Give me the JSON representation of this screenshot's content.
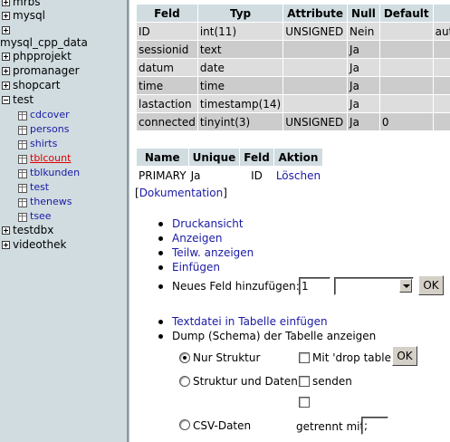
{
  "tree": {
    "databases": [
      {
        "name": "mrbs",
        "expanded": false
      },
      {
        "name": "mysql",
        "expanded": false
      },
      {
        "name": "mysql_cpp_data",
        "expanded": false
      },
      {
        "name": "phpprojekt",
        "expanded": false
      },
      {
        "name": "promanager",
        "expanded": false
      },
      {
        "name": "shopcart",
        "expanded": false
      },
      {
        "name": "test",
        "expanded": true
      },
      {
        "name": "testdbx",
        "expanded": false
      },
      {
        "name": "videothek",
        "expanded": false
      }
    ],
    "test_tables": [
      "cdcover",
      "persons",
      "shirts",
      "tblcount",
      "tblkunden",
      "test",
      "thenews",
      "tsee"
    ],
    "active_table": "tblcount"
  },
  "fields_table": {
    "headers": [
      "Feld",
      "Typ",
      "Attribute",
      "Null",
      "Default"
    ],
    "rows": [
      {
        "feld": "ID",
        "typ": "int(11)",
        "attribute": "UNSIGNED",
        "null": "Nein",
        "default": "",
        "extra": "auto"
      },
      {
        "feld": "sessionid",
        "typ": "text",
        "attribute": "",
        "null": "Ja",
        "default": "",
        "extra": ""
      },
      {
        "feld": "datum",
        "typ": "date",
        "attribute": "",
        "null": "Ja",
        "default": "",
        "extra": ""
      },
      {
        "feld": "time",
        "typ": "time",
        "attribute": "",
        "null": "Ja",
        "default": "",
        "extra": ""
      },
      {
        "feld": "lastaction",
        "typ": "timestamp(14)",
        "attribute": "",
        "null": "Ja",
        "default": "",
        "extra": ""
      },
      {
        "feld": "connected",
        "typ": "tinyint(3)",
        "attribute": "UNSIGNED",
        "null": "Ja",
        "default": "0",
        "extra": ""
      }
    ]
  },
  "index_table": {
    "headers": [
      "Name",
      "Unique",
      "Feld",
      "Aktion"
    ],
    "rows": [
      {
        "name": "PRIMARY",
        "unique": "Ja",
        "feld": "ID",
        "aktion": "Löschen"
      }
    ]
  },
  "doc_link": {
    "open": "[",
    "label": "Dokumentation",
    "close": "]"
  },
  "actions": {
    "druckansicht": "Druckansicht",
    "anzeigen": "Anzeigen",
    "teilw_anzeigen": "Teilw. anzeigen",
    "einfuegen": "Einfügen",
    "neues_feld_label": "Neues Feld hinzufügen:",
    "neues_feld_value": "1",
    "neues_feld_position": "",
    "ok_label": "OK"
  },
  "dump": {
    "textdatei": "Textdatei in Tabelle einfügen",
    "dump_label": "Dump (Schema) der Tabelle anzeigen",
    "nur_struktur": "Nur Struktur",
    "struktur_und_daten": "Struktur und Daten",
    "csv_daten": "CSV-Daten",
    "mit_drop_table": "Mit 'drop table'",
    "senden": "senden",
    "getrennt_mit": "getrennt mit",
    "getrennt_value": ";",
    "ok_label": "OK",
    "selected": "Nur Struktur"
  }
}
